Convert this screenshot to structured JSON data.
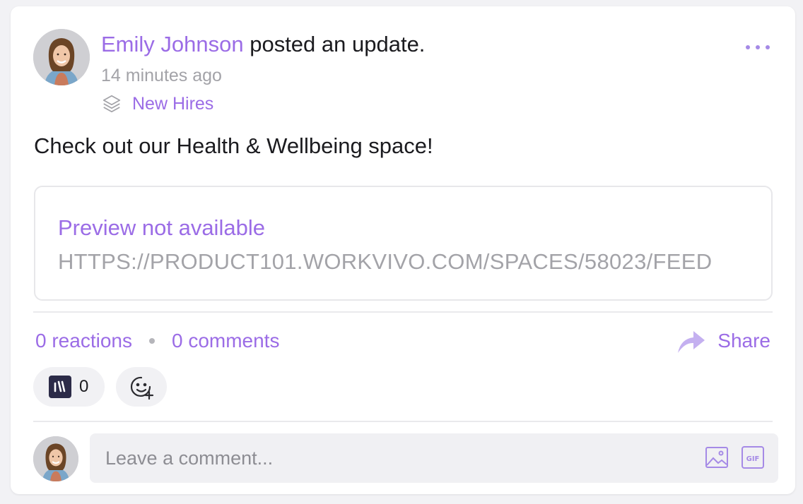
{
  "post": {
    "author": "Emily Johnson",
    "action": " posted an update.",
    "time": "14 minutes ago",
    "space": "New Hires",
    "body": "Check out our Health & Wellbeing space!"
  },
  "preview": {
    "title": "Preview not available",
    "url": "HTTPS://PRODUCT101.WORKVIVO.COM/SPACES/58023/FEED"
  },
  "stats": {
    "reactions": "0 reactions",
    "comments": "0 comments",
    "share": "Share"
  },
  "reaction": {
    "count": "0",
    "icon": "workvivo-logo-icon"
  },
  "comment": {
    "placeholder": "Leave a comment..."
  },
  "icons": {
    "more": "more-dots-icon",
    "space": "layers-icon",
    "share": "share-arrow-icon",
    "add_reaction": "add-emoji-icon",
    "image": "image-icon",
    "gif": "gif-icon"
  },
  "colors": {
    "accent": "#9b6ce6",
    "muted": "#a3a3a8",
    "text": "#1b1b1f",
    "card_bg": "#ffffff",
    "page_bg": "#f2f2f5"
  }
}
